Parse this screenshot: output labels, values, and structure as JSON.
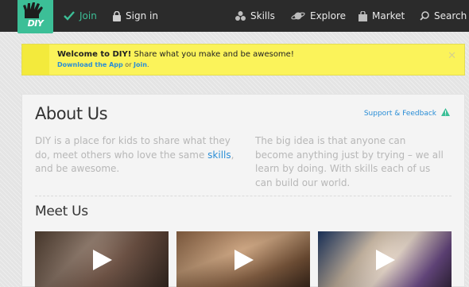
{
  "nav": {
    "logo_text": "DIY",
    "join": "Join",
    "signin": "Sign in",
    "skills": "Skills",
    "explore": "Explore",
    "market": "Market",
    "search": "Search"
  },
  "notice": {
    "title_bold": "Welcome to DIY!",
    "title_rest": " Share what you make and be awesome!",
    "download_link": "Download the App",
    "or_text": " or ",
    "join_link": "Join",
    "period": ".",
    "close": "✕"
  },
  "about": {
    "title": "About Us",
    "support": "Support & Feedback",
    "para1_before": "DIY is a place for kids to share what they do, meet others who love the same ",
    "para1_link": "skills",
    "para1_after": ", and be awesome.",
    "para2": "The big idea is that anyone can become anything just by trying – we all learn by doing. With skills each of us can build our world."
  },
  "meet": {
    "title": "Meet Us",
    "videos": [
      "video-1",
      "video-2",
      "video-3"
    ]
  },
  "colors": {
    "brand": "#3cbf97",
    "link": "#2b8ed6",
    "notice_bg": "#fbf35a",
    "topbar": "#2b2b2b"
  }
}
